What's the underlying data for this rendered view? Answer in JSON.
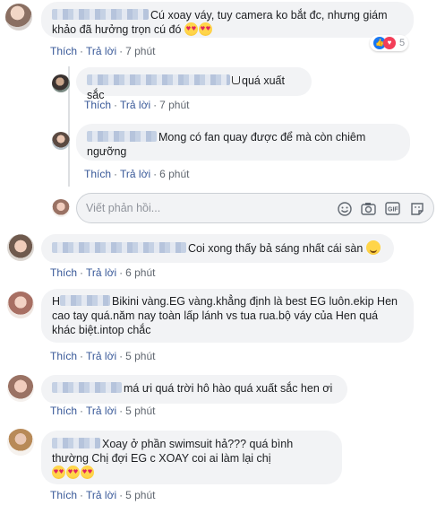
{
  "actions": {
    "like": "Thích",
    "reply": "Trả lời",
    "sep": "·"
  },
  "comments": [
    {
      "text": "Cú xoay váy, tuy camera ko bắt đc, nhưng giám khảo đã hưởng trọn cú đó",
      "time": "7 phút",
      "reaction_count": "5"
    },
    {
      "text": "quá xuất sắc",
      "time": "7 phút"
    },
    {
      "text": "Mong có fan quay được để mà còn chiêm ngưỡng",
      "time": "6 phút"
    },
    {
      "text": "Coi xong thấy bả sáng nhất cái sàn",
      "time": "6 phút"
    },
    {
      "name_prefix": "H",
      "text": "Bikini vàng.EG vàng.khẳng định là best EG luôn.ekip Hen cao tay quá.năm nay toàn lấp lánh vs tua rua.bộ váy của Hen quá khác biệt.intop chắc",
      "time": "5 phút"
    },
    {
      "text": "má ưi quá trời hô hào quá xuất sắc hen ơi",
      "time": "5 phút"
    },
    {
      "text": "Xoay ở phần swimsuit hả??? quá bình thường Chị đợi EG c XOAY coi ai làm lại chị",
      "time": "5 phút"
    }
  ],
  "reply_box": {
    "placeholder": "Viết phản hồi..."
  },
  "icons": [
    "like-icon",
    "love-icon",
    "smiley-icon",
    "camera-icon",
    "gif-icon",
    "sticker-icon"
  ]
}
